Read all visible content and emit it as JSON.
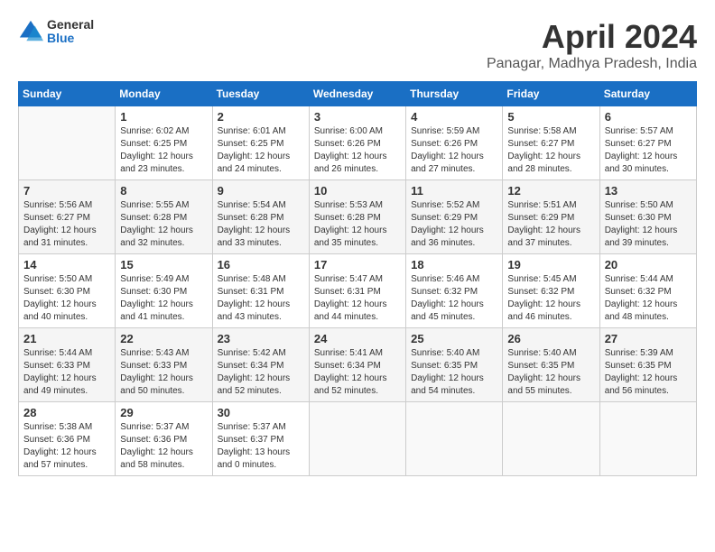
{
  "logo": {
    "general": "General",
    "blue": "Blue"
  },
  "title": "April 2024",
  "subtitle": "Panagar, Madhya Pradesh, India",
  "days_header": [
    "Sunday",
    "Monday",
    "Tuesday",
    "Wednesday",
    "Thursday",
    "Friday",
    "Saturday"
  ],
  "weeks": [
    [
      {
        "day": "",
        "info": ""
      },
      {
        "day": "1",
        "info": "Sunrise: 6:02 AM\nSunset: 6:25 PM\nDaylight: 12 hours\nand 23 minutes."
      },
      {
        "day": "2",
        "info": "Sunrise: 6:01 AM\nSunset: 6:25 PM\nDaylight: 12 hours\nand 24 minutes."
      },
      {
        "day": "3",
        "info": "Sunrise: 6:00 AM\nSunset: 6:26 PM\nDaylight: 12 hours\nand 26 minutes."
      },
      {
        "day": "4",
        "info": "Sunrise: 5:59 AM\nSunset: 6:26 PM\nDaylight: 12 hours\nand 27 minutes."
      },
      {
        "day": "5",
        "info": "Sunrise: 5:58 AM\nSunset: 6:27 PM\nDaylight: 12 hours\nand 28 minutes."
      },
      {
        "day": "6",
        "info": "Sunrise: 5:57 AM\nSunset: 6:27 PM\nDaylight: 12 hours\nand 30 minutes."
      }
    ],
    [
      {
        "day": "7",
        "info": "Sunrise: 5:56 AM\nSunset: 6:27 PM\nDaylight: 12 hours\nand 31 minutes."
      },
      {
        "day": "8",
        "info": "Sunrise: 5:55 AM\nSunset: 6:28 PM\nDaylight: 12 hours\nand 32 minutes."
      },
      {
        "day": "9",
        "info": "Sunrise: 5:54 AM\nSunset: 6:28 PM\nDaylight: 12 hours\nand 33 minutes."
      },
      {
        "day": "10",
        "info": "Sunrise: 5:53 AM\nSunset: 6:28 PM\nDaylight: 12 hours\nand 35 minutes."
      },
      {
        "day": "11",
        "info": "Sunrise: 5:52 AM\nSunset: 6:29 PM\nDaylight: 12 hours\nand 36 minutes."
      },
      {
        "day": "12",
        "info": "Sunrise: 5:51 AM\nSunset: 6:29 PM\nDaylight: 12 hours\nand 37 minutes."
      },
      {
        "day": "13",
        "info": "Sunrise: 5:50 AM\nSunset: 6:30 PM\nDaylight: 12 hours\nand 39 minutes."
      }
    ],
    [
      {
        "day": "14",
        "info": "Sunrise: 5:50 AM\nSunset: 6:30 PM\nDaylight: 12 hours\nand 40 minutes."
      },
      {
        "day": "15",
        "info": "Sunrise: 5:49 AM\nSunset: 6:30 PM\nDaylight: 12 hours\nand 41 minutes."
      },
      {
        "day": "16",
        "info": "Sunrise: 5:48 AM\nSunset: 6:31 PM\nDaylight: 12 hours\nand 43 minutes."
      },
      {
        "day": "17",
        "info": "Sunrise: 5:47 AM\nSunset: 6:31 PM\nDaylight: 12 hours\nand 44 minutes."
      },
      {
        "day": "18",
        "info": "Sunrise: 5:46 AM\nSunset: 6:32 PM\nDaylight: 12 hours\nand 45 minutes."
      },
      {
        "day": "19",
        "info": "Sunrise: 5:45 AM\nSunset: 6:32 PM\nDaylight: 12 hours\nand 46 minutes."
      },
      {
        "day": "20",
        "info": "Sunrise: 5:44 AM\nSunset: 6:32 PM\nDaylight: 12 hours\nand 48 minutes."
      }
    ],
    [
      {
        "day": "21",
        "info": "Sunrise: 5:44 AM\nSunset: 6:33 PM\nDaylight: 12 hours\nand 49 minutes."
      },
      {
        "day": "22",
        "info": "Sunrise: 5:43 AM\nSunset: 6:33 PM\nDaylight: 12 hours\nand 50 minutes."
      },
      {
        "day": "23",
        "info": "Sunrise: 5:42 AM\nSunset: 6:34 PM\nDaylight: 12 hours\nand 52 minutes."
      },
      {
        "day": "24",
        "info": "Sunrise: 5:41 AM\nSunset: 6:34 PM\nDaylight: 12 hours\nand 52 minutes."
      },
      {
        "day": "25",
        "info": "Sunrise: 5:40 AM\nSunset: 6:35 PM\nDaylight: 12 hours\nand 54 minutes."
      },
      {
        "day": "26",
        "info": "Sunrise: 5:40 AM\nSunset: 6:35 PM\nDaylight: 12 hours\nand 55 minutes."
      },
      {
        "day": "27",
        "info": "Sunrise: 5:39 AM\nSunset: 6:35 PM\nDaylight: 12 hours\nand 56 minutes."
      }
    ],
    [
      {
        "day": "28",
        "info": "Sunrise: 5:38 AM\nSunset: 6:36 PM\nDaylight: 12 hours\nand 57 minutes."
      },
      {
        "day": "29",
        "info": "Sunrise: 5:37 AM\nSunset: 6:36 PM\nDaylight: 12 hours\nand 58 minutes."
      },
      {
        "day": "30",
        "info": "Sunrise: 5:37 AM\nSunset: 6:37 PM\nDaylight: 13 hours\nand 0 minutes."
      },
      {
        "day": "",
        "info": ""
      },
      {
        "day": "",
        "info": ""
      },
      {
        "day": "",
        "info": ""
      },
      {
        "day": "",
        "info": ""
      }
    ]
  ]
}
